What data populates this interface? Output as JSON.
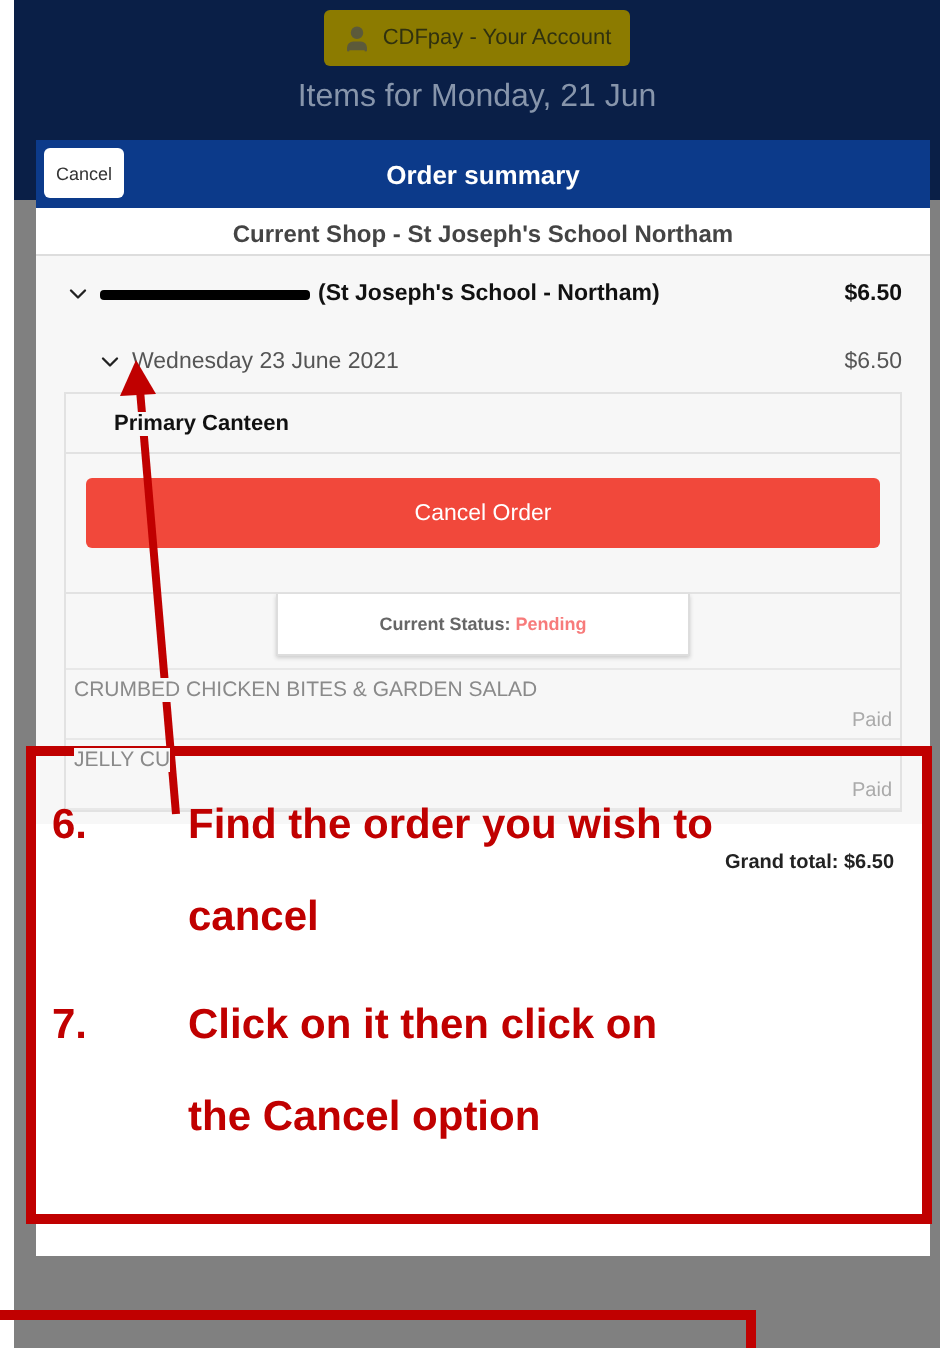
{
  "header": {
    "account_button": "CDFpay - Your Account",
    "title": "Items for Monday, 21 Jun"
  },
  "modal": {
    "cancel_button": "Cancel",
    "title": "Order summary",
    "shop": "Current Shop - St Joseph's School Northam",
    "student": {
      "school": "(St Joseph's School - Northam)",
      "total": "$6.50",
      "expanded": true
    },
    "day": {
      "date": "Wednesday 23 June 2021",
      "total": "$6.50",
      "expanded": true
    },
    "canteen": "Primary Canteen",
    "cancel_order_button": "Cancel Order",
    "status": {
      "label": "Current Status:",
      "value": "Pending"
    },
    "items": [
      {
        "name": "CRUMBED CHICKEN BITES & GARDEN SALAD",
        "payment": "Paid"
      },
      {
        "name": "JELLY CU",
        "payment": "Paid"
      }
    ],
    "grand_total": "Grand total: $6.50"
  },
  "annotations": [
    {
      "number": "6.",
      "text": "Find the order you wish to cancel"
    },
    {
      "number": "7.",
      "text": "Click on it then click on the Cancel option"
    }
  ]
}
